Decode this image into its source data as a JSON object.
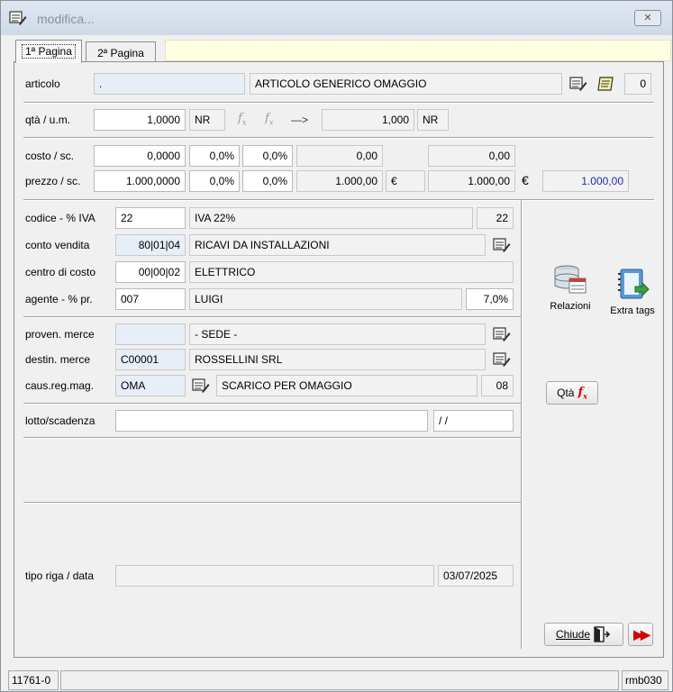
{
  "window": {
    "title": "modifica..."
  },
  "tabs": [
    {
      "label": "1ª Pagina"
    },
    {
      "label": "2ª Pagina"
    }
  ],
  "articolo": {
    "label": "articolo",
    "code": ".",
    "description": "ARTICOLO GENERICO OMAGGIO",
    "count": "0"
  },
  "qta": {
    "label": "qtà / u.m.",
    "value": "1,0000",
    "unit": "NR",
    "arrow": "—>",
    "converted": "1,000",
    "converted_unit": "NR"
  },
  "costo": {
    "label": "costo / sc.",
    "value": "0,0000",
    "sc1": "0,0%",
    "sc2": "0,0%",
    "net": "0,00",
    "total": "0,00"
  },
  "prezzo": {
    "label": "prezzo / sc.",
    "value": "1.000,0000",
    "sc1": "0,0%",
    "sc2": "0,0%",
    "net": "1.000,00",
    "currency": "€",
    "total": "1.000,00",
    "currency2": "€",
    "final": "1.000,00"
  },
  "iva": {
    "label": "codice - % IVA",
    "code": "22",
    "description": "IVA 22%",
    "percent": "22"
  },
  "conto": {
    "label": "conto vendita",
    "code": "80|01|04",
    "description": "RICAVI DA INSTALLAZIONI"
  },
  "centro": {
    "label": "centro di costo",
    "code": "00|00|02",
    "description": "ELETTRICO"
  },
  "agente": {
    "label": "agente - % pr.",
    "code": "007",
    "name": "LUIGI",
    "percent": "7,0%"
  },
  "proven": {
    "label": "proven. merce",
    "code": "",
    "description": "- SEDE -"
  },
  "destin": {
    "label": "destin. merce",
    "code": "C00001",
    "description": "ROSSELLINI SRL"
  },
  "caus": {
    "label": "caus.reg.mag.",
    "code": "OMA",
    "description": "SCARICO PER OMAGGIO",
    "num": "08"
  },
  "lotto": {
    "label": "lotto/scadenza",
    "value": "",
    "date": "/ /"
  },
  "tiporiga": {
    "label": "tipo riga / data",
    "value": "",
    "date": "03/07/2025"
  },
  "side": {
    "relazioni": "Relazioni",
    "extra_tags": "Extra tags",
    "qta_fx": "Qtà",
    "chiude": "Chiude"
  },
  "status": {
    "left": "11761-0",
    "middle": "",
    "right": "rmb030"
  },
  "colors": {
    "titlebar": "#dfe7f2",
    "note_bg": "#fdfde0",
    "blue_text": "#1a2fa8",
    "fx_red": "#d40000",
    "forward_red": "#d40000",
    "book_blue": "#3a7dc8",
    "green_arrow": "#3aa23a"
  }
}
